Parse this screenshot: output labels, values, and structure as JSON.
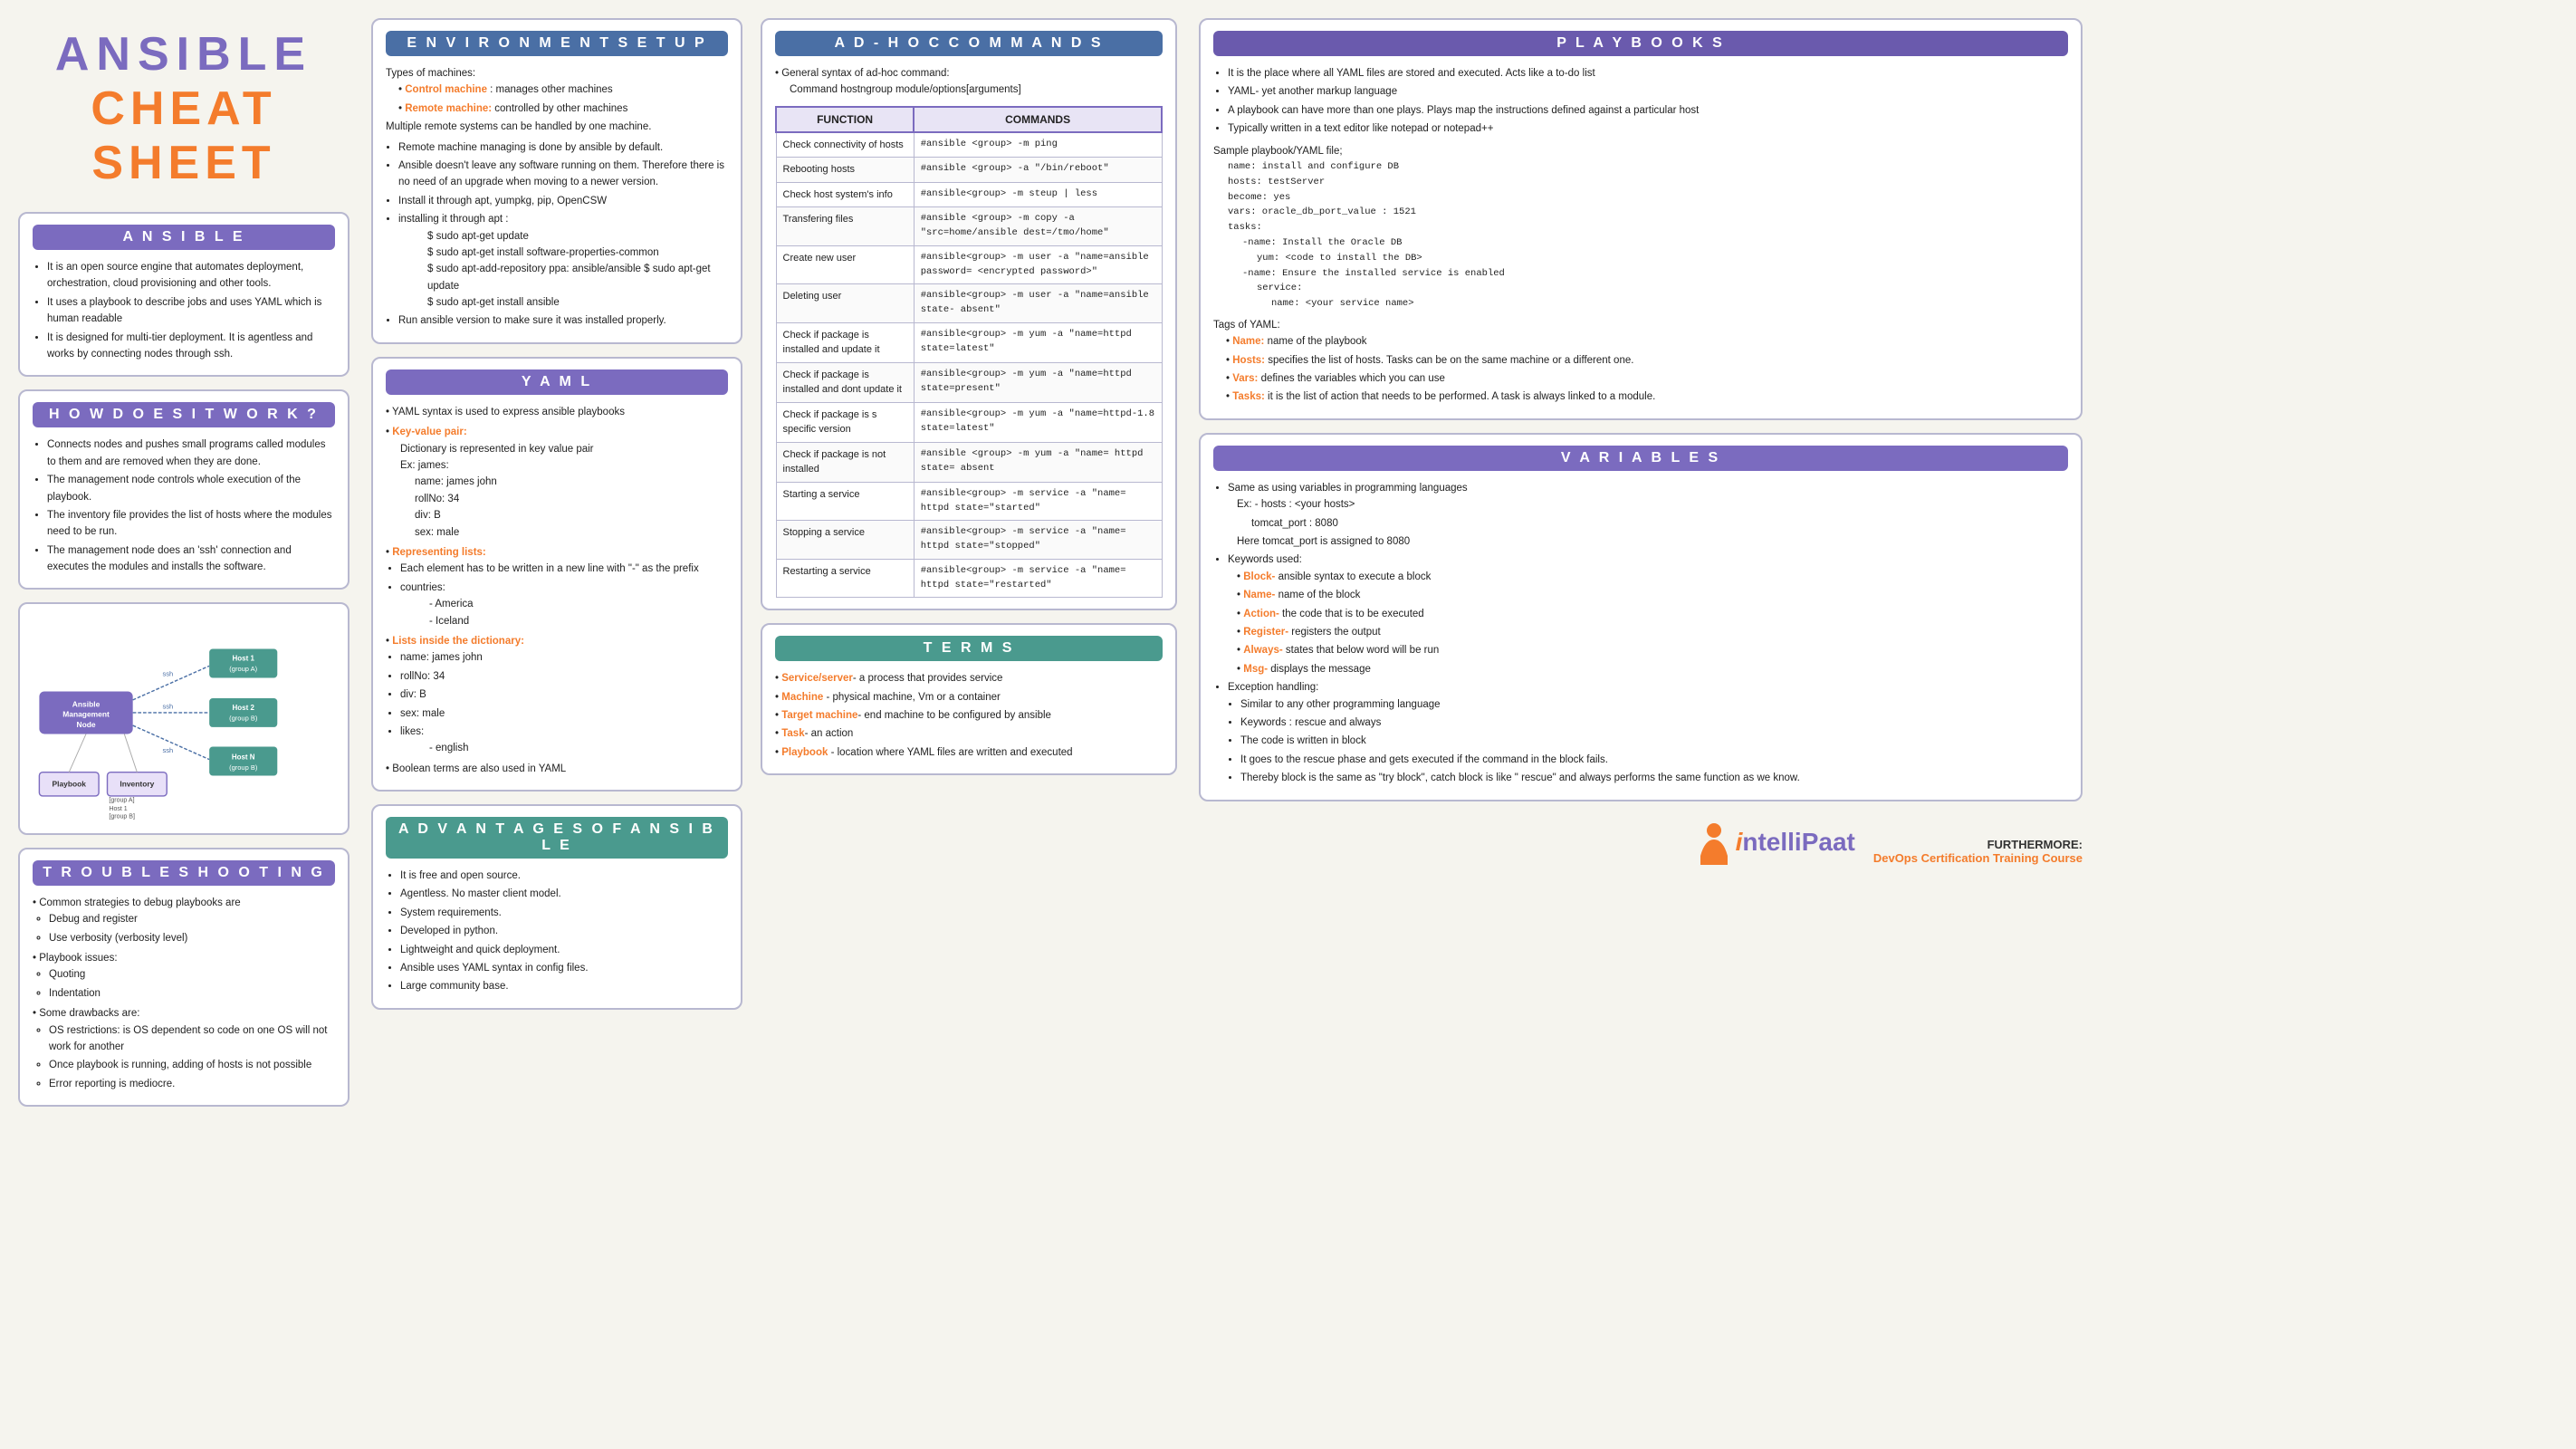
{
  "title": {
    "ansible": "ANSIBLE",
    "cheatsheet": "CHEAT SHEET"
  },
  "ansible_section": {
    "header": "A n s i b l e",
    "points": [
      "It is an open source engine that automates deployment, orchestration, cloud provisioning and other tools.",
      "It uses a playbook to describe jobs and uses YAML which is human readable",
      "It is designed for multi-tier deployment. It is agentless and works by connecting nodes through ssh."
    ]
  },
  "how_it_works": {
    "header": "H o w   D o e s   i t   W o r k ?",
    "points": [
      "Connects nodes and pushes small programs called modules to them and are removed when they are done.",
      "The management node controls whole execution of the playbook.",
      "The inventory file provides the list of hosts where the modules need to be run.",
      "The management node does an 'ssh' connection and executes the modules and installs the software."
    ]
  },
  "troubleshooting": {
    "header": "T r o u b l e s h o o t i n g",
    "content": [
      "Common strategies to debug playbooks are",
      "Debug and register",
      "Use verbosity (verbosity level)",
      "Playbook issues:",
      "Quoting",
      "Indentation",
      "Some drawbacks are:",
      "OS restrictions: is OS dependent so code on one OS will not work for another",
      "Once playbook is running, adding of hosts is not possible",
      "Error reporting is mediocre."
    ]
  },
  "environment_setup": {
    "header": "E n v i r o n m e n t   S e t u p",
    "types_label": "Types of machines:",
    "control_machine": "Control machine : manages other machines",
    "remote_machine": "Remote machine: controlled by other machines",
    "points": [
      "Multiple remote systems can be handled by one machine.",
      "Remote machine managing is done by ansible by default.",
      "Ansible doesn't leave any software running on them. Therefore there is no need of an upgrade when moving to a newer version.",
      "Install it through apt, yumpkg, pip, OpenCSW",
      "installing it through apt :",
      "$ sudo apt-get update",
      "$ sudo apt-get install software-properties-common",
      "$ sudo apt-add-repository ppa: ansible/ansible $ sudo apt-get update",
      "$ sudo apt-get install ansible",
      "Run ansible version to make sure it was installed properly."
    ]
  },
  "yaml_section": {
    "header": "Y A M L",
    "points": [
      "YAML syntax is used to express ansible playbooks",
      "Key-value pair:",
      "Dictionary is represented in key value pair",
      "Ex: james:",
      "name: james john",
      "rollNo: 34",
      "div: B",
      "sex: male",
      "Representing lists:",
      "Each element has to be written in a new line with \"-\" as the prefix",
      "countries:",
      "- America",
      "- Iceland",
      "Lists inside the dictionary:",
      "name: james john",
      "rollNo: 34",
      "div: B",
      "sex: male",
      "likes:",
      "- english",
      "Boolean terms are also used in YAML"
    ]
  },
  "advantages": {
    "header": "A d v a n t a g e s   o f   A n s i b l e",
    "points": [
      "It is free and open source.",
      "Agentless. No master client model.",
      "System requirements.",
      "Developed in python.",
      "Lightweight and quick deployment.",
      "Ansible uses YAML syntax in config files.",
      "Large community base."
    ]
  },
  "adhoc": {
    "header": "A d - h o c   C o m m a n d s",
    "syntax_label": "General syntax of ad-hoc command:",
    "syntax": "Command hostngroup module/options[arguments]",
    "table_headers": [
      "FUNCTION",
      "COMMANDS"
    ],
    "table_rows": [
      [
        "Check connectivity of hosts",
        "#ansible <group> -m ping"
      ],
      [
        "Rebooting hosts",
        "#ansible <group> -a \"/bin/reboot\""
      ],
      [
        "Check host system's info",
        "#ansible<group> -m steup | less"
      ],
      [
        "Transfering files",
        "#ansible <group> -m copy -a \"src=home/ansible dest=/tmo/home\""
      ],
      [
        "Create new user",
        "#ansible<group> -m user -a \"name=ansible password= <encrypted password>\""
      ],
      [
        "Deleting user",
        "#ansible<group> -m user -a \"name=ansible state- absent\""
      ],
      [
        "Check if package is installed and update it",
        "#ansible<group> -m yum -a \"name=httpd state=latest\""
      ],
      [
        "Check if package is installed and dont update it",
        "#ansible<group> -m yum -a \"name=httpd state=present\""
      ],
      [
        "Check if package is s specific version",
        "#ansible<group> -m yum -a \"name=httpd-1.8 state=latest\""
      ],
      [
        "Check if package is not installed",
        "#ansible <group> -m yum -a \"name= httpd state= absent"
      ],
      [
        "Starting a service",
        "#ansible<group> -m service -a \"name= httpd state=\"started\""
      ],
      [
        "Stopping a service",
        "#ansible<group> -m service -a \"name= httpd state=\"stopped\""
      ],
      [
        "Restarting a service",
        "#ansible<group> -m service -a \"name= httpd state=\"restarted\""
      ]
    ]
  },
  "terms": {
    "header": "T e r m s",
    "items": [
      {
        "label": "Service/server",
        "color": "orange",
        "text": "a process that provides service"
      },
      {
        "label": "Machine",
        "color": "orange",
        "text": "physical machine, Vm or a container"
      },
      {
        "label": "Target machine",
        "color": "orange",
        "text": "end machine to be configured by ansible"
      },
      {
        "label": "Task",
        "color": "orange",
        "text": "an action"
      },
      {
        "label": "Playbook",
        "color": "orange",
        "text": "location where YAML files are written and executed"
      }
    ]
  },
  "playbooks": {
    "header": "P l a y b o o k s",
    "points": [
      "It is the place where all YAML files are stored and executed. Acts like a to-do list",
      "YAML- yet another markup language",
      "A playbook can have more than one plays. Plays map the instructions defined against a particular host",
      "Typically written in a text editor like notepad or notepad++",
      "Sample playbook/YAML file;",
      "name: install and configure DB",
      "hosts: testServer",
      "become: yes",
      "vars: oracle_db_port_value : 1521",
      "tasks:",
      "-name: Install the Oracle DB",
      "yum: <code to install the DB>",
      "-name: Ensure the installed service is enabled",
      "service:",
      "name: <your service name>",
      "Tags of YAML:",
      "Name: name of the playbook",
      "Hosts: specifies the list of hosts. Tasks can be on the same machine or a different one.",
      "Vars: defines the variables which you can use",
      "Tasks: it is the list of action that needs to be performed. A task is always linked to a module."
    ]
  },
  "variables": {
    "header": "V a r i a b l e s",
    "points": [
      "Same as using variables in programming languages",
      "Ex: - hosts : <your hosts>",
      "tomcat_port : 8080",
      "Here tomcat_port is assigned to 8080",
      "Keywords used:",
      "Block- ansible syntax to execute a block",
      "Name- name of the block",
      "Action- the code that is to be executed",
      "Register- registers the output",
      "Always- states that below word will be run",
      "Msg- displays the message",
      "Exception handling:",
      "Similar to any other programming language",
      "Keywords : rescue and always",
      "The code is written in block",
      "It goes to the rescue phase and gets executed if the command in the block fails.",
      "Thereby block is the same as \"try block\", catch block is like \" rescue\" and always performs the same function as we know."
    ]
  },
  "brand": {
    "logo_i": "i",
    "logo_name": "ntelliPaat",
    "furthermore": "FURTHERMORE:",
    "course": "DevOps Certification Training Course"
  }
}
